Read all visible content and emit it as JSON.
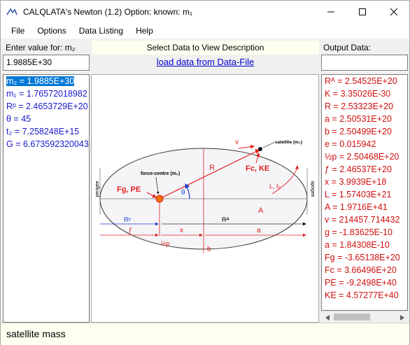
{
  "window": {
    "title": "CALQLATA's  Newton (1.2)  Option: known: m₁"
  },
  "menu": [
    "File",
    "Options",
    "Data Listing",
    "Help"
  ],
  "input": {
    "label": "Enter value for: m₂",
    "value": "1.9885E+30"
  },
  "description_header": "Select Data to View Description",
  "load_link": "load data from Data-File",
  "output": {
    "label": "Output Data:",
    "value": ""
  },
  "known_values": [
    "m₂ = 1.9885E+30",
    "m₁ = 1.76572018982",
    "Rᵖ = 2.4653729E+20",
    "θ = 45",
    "t₂ = 7.258248E+15",
    "G = 6.673592320043"
  ],
  "output_values": [
    "Rᴬ = 2.54525E+20",
    "K = 3.35026E-30",
    "R = 2.53323E+20",
    "a = 2.50531E+20",
    "b = 2.50499E+20",
    "e = 0.015942",
    "½p = 2.50468E+20",
    "ƒ = 2.46537E+20",
    "x = 3.9939E+18",
    "L = 1.57403E+21",
    "A = 1.9716E+41",
    "v = 214457.714432",
    "g = -1.83625E-10",
    "a = 1.84308E-10",
    "Fg = -3.65138E+20",
    "Fc = 3.66496E+20",
    "PE = -9.2498E+40",
    "KE = 4.57277E+40"
  ],
  "diagram": {
    "satellite_label": "satellite (m₂)",
    "force_centre_label": "force-centre (m₁)",
    "perigee": "perigee",
    "apogee": "apogee",
    "fg_pe": "Fg, PE",
    "fc_ke": "Fc, KE",
    "R": "R",
    "v": "v",
    "theta": "θ",
    "L_t2": "L, t₂",
    "A": "A",
    "Rp": "Rᵖ",
    "RA": "Rᴬ",
    "f": "ƒ",
    "x": "x",
    "a": "a",
    "half_p": "½p",
    "b": "b"
  },
  "status": "satellite mass"
}
